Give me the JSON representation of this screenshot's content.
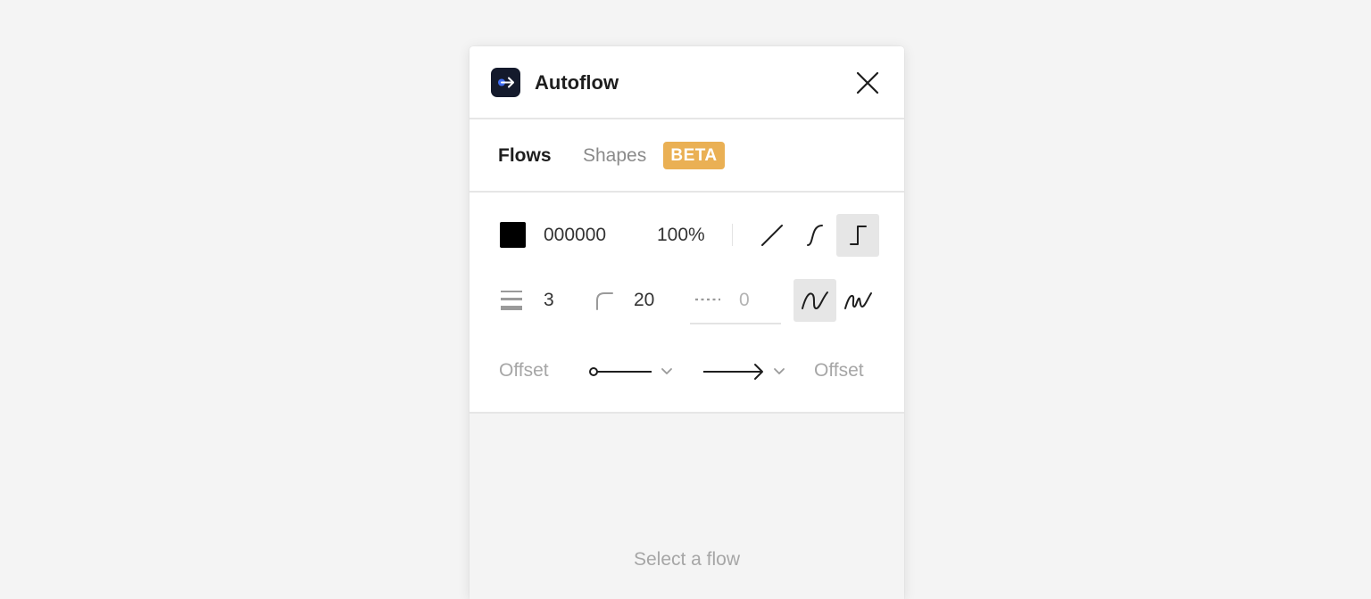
{
  "window": {
    "title": "Autoflow",
    "app_icon": "autoflow-logo-icon",
    "close_icon": "close-icon"
  },
  "tabs": {
    "flows_label": "Flows",
    "shapes_label": "Shapes",
    "shapes_badge": "BETA",
    "active": "Flows"
  },
  "style": {
    "color_hex": "000000",
    "color_value": "#000000",
    "opacity": "100%",
    "line_types": [
      {
        "name": "straight",
        "icon": "straight-line-icon",
        "selected": false
      },
      {
        "name": "curved",
        "icon": "curved-line-icon",
        "selected": false
      },
      {
        "name": "angled",
        "icon": "angled-line-icon",
        "selected": true
      }
    ],
    "stroke_width": "3",
    "corner_radius": "20",
    "dash": "0",
    "line_styles": [
      {
        "name": "smooth",
        "icon": "smooth-line-icon",
        "selected": true
      },
      {
        "name": "sketchy",
        "icon": "sketchy-line-icon",
        "selected": false
      }
    ],
    "start_offset_label": "Offset",
    "start_cap": "circle",
    "end_cap": "arrow",
    "end_offset_label": "Offset"
  },
  "empty_state": {
    "message": "Select a flow"
  },
  "colors": {
    "background": "#f4f4f4",
    "badge": "#eab054",
    "app_icon_bg": "#141a2c",
    "app_icon_accent": "#3f6cf0",
    "selected_bg": "#e6e6e6"
  }
}
